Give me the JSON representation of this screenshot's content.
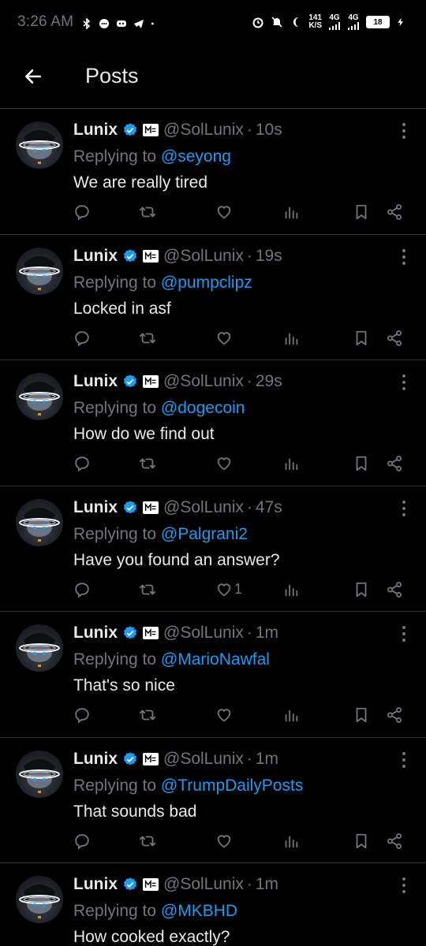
{
  "status_bar": {
    "time": "3:26 AM",
    "net_speed_value": "141",
    "net_speed_unit": "K/S",
    "signal1": "4G",
    "signal2": "4G",
    "battery": "18"
  },
  "header": {
    "title": "Posts"
  },
  "posts": [
    {
      "name": "Lunix",
      "handle": "@SolLunix",
      "time": "10s",
      "reply_prefix": "Replying to",
      "reply_to": "@seyong",
      "text": "We are really tired",
      "likes": ""
    },
    {
      "name": "Lunix",
      "handle": "@SolLunix",
      "time": "19s",
      "reply_prefix": "Replying to",
      "reply_to": "@pumpclipz",
      "text": "Locked in asf",
      "likes": ""
    },
    {
      "name": "Lunix",
      "handle": "@SolLunix",
      "time": "29s",
      "reply_prefix": "Replying to",
      "reply_to": "@dogecoin",
      "text": "How do we find out",
      "likes": ""
    },
    {
      "name": "Lunix",
      "handle": "@SolLunix",
      "time": "47s",
      "reply_prefix": "Replying to",
      "reply_to": "@Palgrani2",
      "text": "Have you found an answer?",
      "likes": "1"
    },
    {
      "name": "Lunix",
      "handle": "@SolLunix",
      "time": "1m",
      "reply_prefix": "Replying to",
      "reply_to": "@MarioNawfal",
      "text": "That's so nice",
      "likes": ""
    },
    {
      "name": "Lunix",
      "handle": "@SolLunix",
      "time": "1m",
      "reply_prefix": "Replying to",
      "reply_to": "@TrumpDailyPosts",
      "text": "That sounds bad",
      "likes": ""
    },
    {
      "name": "Lunix",
      "handle": "@SolLunix",
      "time": "1m",
      "reply_prefix": "Replying to",
      "reply_to": "@MKBHD",
      "text": "How cooked exactly?",
      "likes": ""
    }
  ],
  "colors": {
    "background": "#000000",
    "link": "#1d9bf0",
    "muted": "#71767b",
    "text": "#e7e9ea",
    "divider": "#2f3336"
  },
  "icons": {
    "back": "arrow-left-icon",
    "verified": "verified-badge-icon",
    "affiliate": "affiliate-logo-icon",
    "more": "more-vertical-icon",
    "reply": "reply-icon",
    "repost": "repost-icon",
    "like": "heart-icon",
    "views": "views-icon",
    "bookmark": "bookmark-icon",
    "share": "share-icon"
  }
}
